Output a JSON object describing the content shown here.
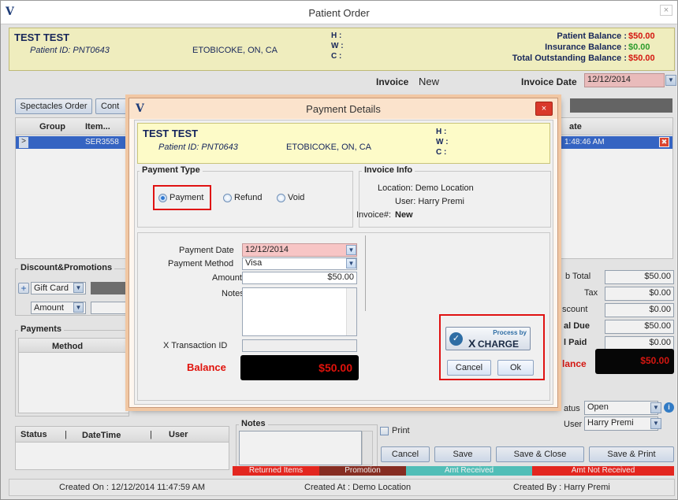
{
  "window": {
    "title": "Patient Order",
    "close_label": "×"
  },
  "patient": {
    "name": "TEST TEST",
    "id_label": "Patient ID: PNT0643",
    "location": "ETOBICOKE, ON, CA",
    "phone_labels": [
      "H :",
      "W :",
      "C :"
    ]
  },
  "balances": {
    "patient_label": "Patient Balance :",
    "patient_value": "$50.00",
    "insurance_label": "Insurance Balance :",
    "insurance_value": "$0.00",
    "outstanding_label": "Total Outstanding Balance :",
    "outstanding_value": "$50.00"
  },
  "invoice": {
    "label": "Invoice",
    "value": "New",
    "date_label": "Invoice Date",
    "date_value": "12/12/2014"
  },
  "tabs": [
    "Spectacles Order",
    "Cont"
  ],
  "grid": {
    "columns": [
      "Group",
      "Item..."
    ],
    "row": {
      "arrow": ">",
      "item": "SER3558"
    },
    "right_col_header": "ate",
    "right_col_value": "1:48:46 AM"
  },
  "discounts": {
    "title": "Discount&Promotions",
    "gift_card": "Gift Card",
    "amount": "Amount"
  },
  "payments": {
    "title": "Payments",
    "method_col": "Method"
  },
  "totals": {
    "rows": [
      {
        "label": "b Total",
        "value": "$50.00"
      },
      {
        "label": "Tax",
        "value": "$0.00"
      },
      {
        "label": "scount",
        "value": "$0.00"
      },
      {
        "label": "al Due",
        "value": "$50.00"
      },
      {
        "label": "l Paid",
        "value": "$0.00"
      }
    ],
    "balance_label": "lance",
    "balance_value": "$50.00"
  },
  "status_section": {
    "status_label": "atus",
    "status_value": "Open",
    "user_label": "User",
    "user_value": "Harry Premi"
  },
  "history": {
    "columns": [
      "Status",
      "|",
      "DateTime",
      "|",
      "User"
    ]
  },
  "notes_title": "Notes",
  "print_label": "Print",
  "buttons": {
    "cancel": "Cancel",
    "save": "Save",
    "save_close": "Save & Close",
    "save_print": "Save & Print"
  },
  "legends": [
    {
      "label": "Returned Items",
      "color": "#f0231c"
    },
    {
      "label": "Promotion",
      "color": "#8b2b1f"
    },
    {
      "label": "Amt Received",
      "color": "#52c8c1"
    },
    {
      "label": "Amt Not Received",
      "color": "#f0231c"
    }
  ],
  "footer": {
    "created_on": "Created On : 12/12/2014 11:47:59 AM",
    "created_at": "Created At : Demo Location",
    "created_by": "Created By : Harry Premi"
  },
  "dialog": {
    "title": "Payment Details",
    "close_label": "×",
    "patient_name": "TEST TEST",
    "patient_id": "Patient ID: PNT0643",
    "location": "ETOBICOKE, ON, CA",
    "phone_labels": [
      "H :",
      "W :",
      "C :"
    ],
    "payment_type_title": "Payment Type",
    "options": [
      "Payment",
      "Refund",
      "Void"
    ],
    "invoice_info_title": "Invoice Info",
    "info_location": "Location: Demo Location",
    "info_user": "User: Harry Premi",
    "info_invoice_label": "Invoice#:",
    "info_invoice_value": "New",
    "payment_date_label": "Payment Date",
    "payment_date_value": "12/12/2014",
    "payment_method_label": "Payment Method",
    "payment_method_value": "Visa",
    "amount_label": "Amount",
    "amount_value": "$50.00",
    "notes_label": "Notes",
    "xtrans_label": "X Transaction ID",
    "balance_label": "Balance",
    "balance_value": "$50.00",
    "xcharge_top": "Process by",
    "xcharge_main": "CHARGE",
    "xcharge_x": "X",
    "cancel": "Cancel",
    "ok": "Ok"
  }
}
